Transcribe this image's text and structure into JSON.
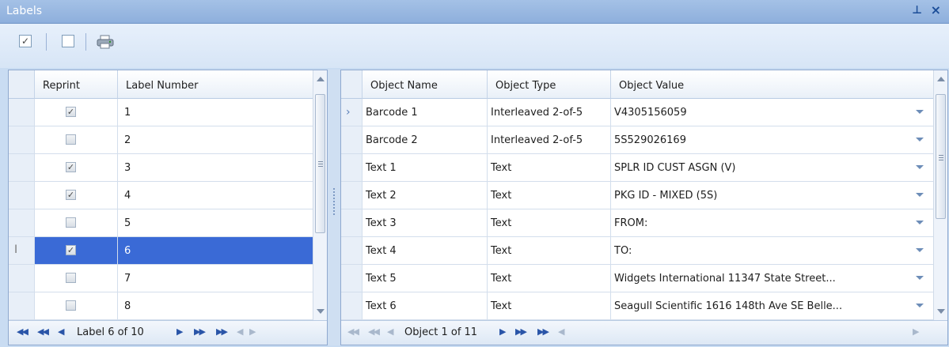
{
  "window": {
    "title": "Labels",
    "pin_glyph": "ᵖ",
    "close_glyph": "✕"
  },
  "toolbar": {
    "check_all_icon": "check-all-icon",
    "uncheck_all_icon": "uncheck-all-icon",
    "print_icon": "printer-icon"
  },
  "labels_grid": {
    "headers": {
      "reprint": "Reprint",
      "label_number": "Label Number"
    },
    "rows": [
      {
        "reprint": true,
        "label_number": "1"
      },
      {
        "reprint": false,
        "label_number": "2"
      },
      {
        "reprint": true,
        "label_number": "3"
      },
      {
        "reprint": true,
        "label_number": "4"
      },
      {
        "reprint": false,
        "label_number": "5"
      },
      {
        "reprint": true,
        "label_number": "6",
        "selected": true
      },
      {
        "reprint": false,
        "label_number": "7"
      },
      {
        "reprint": false,
        "label_number": "8"
      }
    ],
    "navigator": {
      "status": "Label 6 of 10"
    }
  },
  "objects_grid": {
    "headers": {
      "name": "Object Name",
      "type": "Object Type",
      "value": "Object Value"
    },
    "rows": [
      {
        "name": "Barcode 1",
        "type": "Interleaved 2-of-5",
        "value": "V4305156059",
        "current": true
      },
      {
        "name": "Barcode 2",
        "type": "Interleaved 2-of-5",
        "value": "5S529026169"
      },
      {
        "name": "Text 1",
        "type": "Text",
        "value": "SPLR ID CUST ASGN (V)"
      },
      {
        "name": "Text 2",
        "type": "Text",
        "value": "PKG ID - MIXED  (5S)"
      },
      {
        "name": "Text 3",
        "type": "Text",
        "value": "FROM:"
      },
      {
        "name": "Text 4",
        "type": "Text",
        "value": "TO:"
      },
      {
        "name": "Text 5",
        "type": "Text",
        "value": "Widgets International 11347 State Street..."
      },
      {
        "name": "Text 6",
        "type": "Text",
        "value": "Seagull Scientific 1616 148th Ave SE Belle..."
      }
    ],
    "navigator": {
      "status": "Object 1 of 11"
    }
  },
  "colors": {
    "selection": "#3a6ad6",
    "titlebar": "#8eafdc",
    "toolbar": "#dbe8f7"
  }
}
